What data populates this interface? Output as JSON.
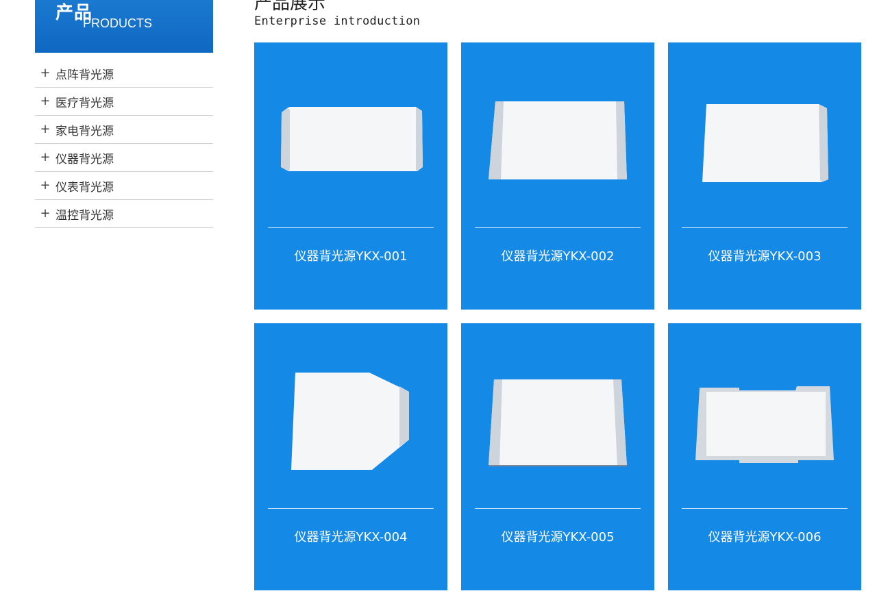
{
  "sidebar": {
    "title_cn": "产品",
    "title_en": "PRODUCTS",
    "items": [
      {
        "label": "点阵背光源"
      },
      {
        "label": "医疗背光源"
      },
      {
        "label": "家电背光源"
      },
      {
        "label": "仪器背光源"
      },
      {
        "label": "仪表背光源"
      },
      {
        "label": "温控背光源"
      }
    ],
    "expand_symbol": "+"
  },
  "main": {
    "title": "产品展示",
    "subtitle": "Enterprise introduction",
    "products": [
      {
        "name": "仪器背光源YKX-001"
      },
      {
        "name": "仪器背光源YKX-002"
      },
      {
        "name": "仪器背光源YKX-003"
      },
      {
        "name": "仪器背光源YKX-004"
      },
      {
        "name": "仪器背光源YKX-005"
      },
      {
        "name": "仪器背光源YKX-006"
      }
    ]
  },
  "colors": {
    "brand_blue": "#1589e6",
    "header_blue": "#0f68c2",
    "panel_white": "#f4f6f8",
    "panel_edge": "#c9d0d8"
  }
}
